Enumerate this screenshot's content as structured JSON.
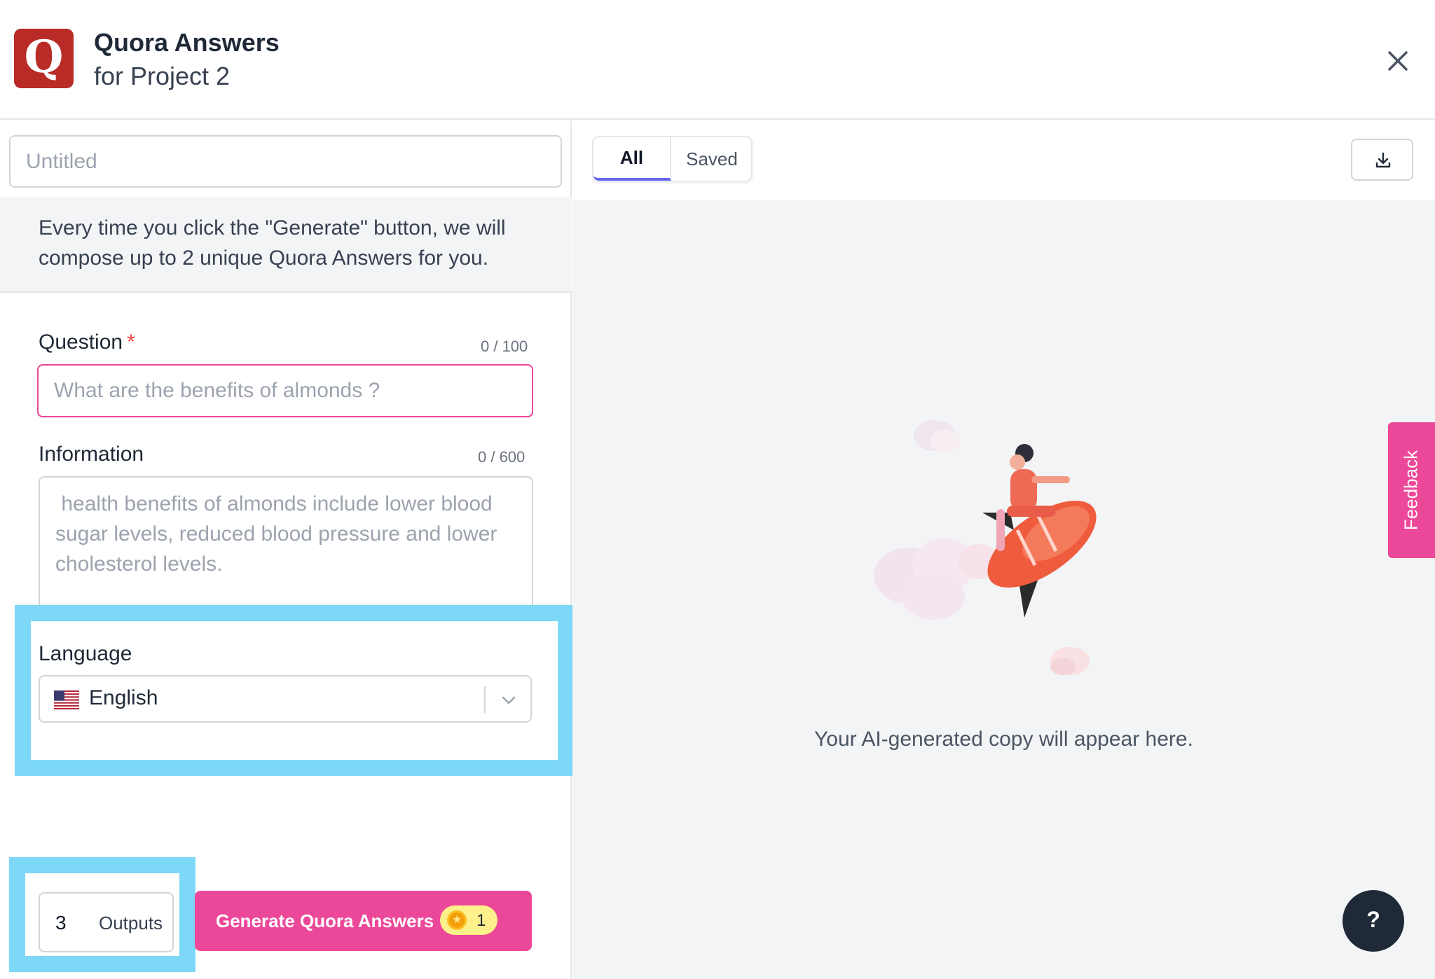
{
  "header": {
    "logo_letter": "Q",
    "title": "Quora Answers",
    "subtitle": "for Project 2",
    "logo_color": "#b92b27"
  },
  "form": {
    "doc_title_placeholder": "Untitled",
    "intro_text": "Every time you click the \"Generate\" button, we will compose up to 2 unique Quora Answers for you.",
    "question": {
      "label": "Question",
      "required_mark": "*",
      "counter": "0 / 100",
      "placeholder": "What are the benefits of almonds ?",
      "value": ""
    },
    "information": {
      "label": "Information",
      "counter": "0 / 600",
      "placeholder": " health benefits of almonds include lower blood sugar levels, reduced blood pressure and lower cholesterol levels.",
      "value": ""
    },
    "language": {
      "label": "Language",
      "selected": "English",
      "flag_icon": "us-flag-icon"
    },
    "outputs": {
      "count": "3",
      "label": "Outputs"
    },
    "generate": {
      "label": "Generate Quora Answers",
      "credit_cost": "1"
    }
  },
  "results": {
    "tabs": [
      {
        "label": "All",
        "active": true
      },
      {
        "label": "Saved",
        "active": false
      }
    ],
    "empty_message": "Your AI-generated copy will appear here."
  },
  "feedback": {
    "label": "Feedback"
  },
  "help": {
    "label": "?"
  },
  "colors": {
    "accent_pink": "#ec4899",
    "highlight": "#7dd8f8",
    "tab_indicator": "#6366f1"
  }
}
